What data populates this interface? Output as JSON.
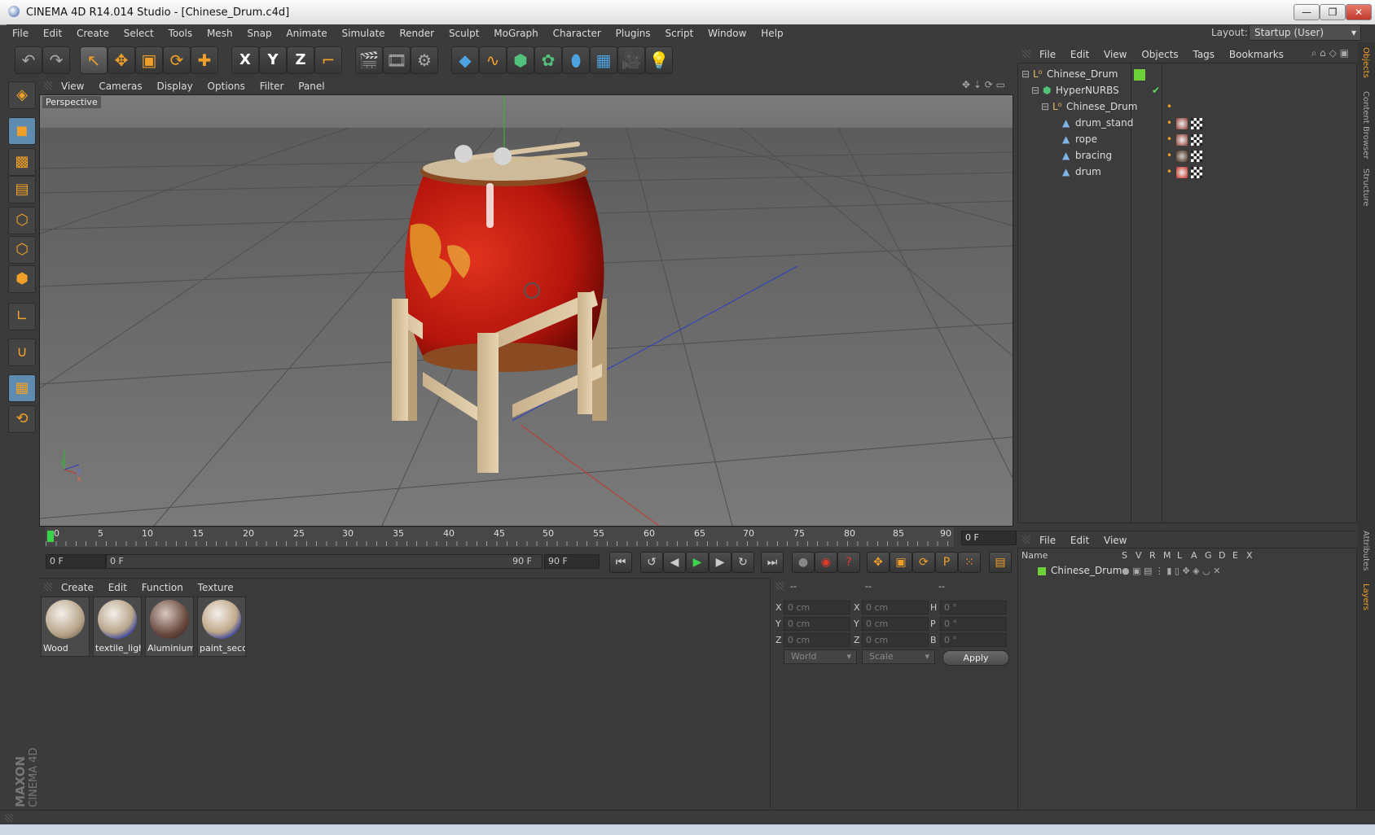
{
  "window": {
    "title": "CINEMA 4D R14.014 Studio - [Chinese_Drum.c4d]",
    "min_label": "—",
    "max_label": "❐",
    "close_label": "✕"
  },
  "menubar": {
    "items": [
      "File",
      "Edit",
      "Create",
      "Select",
      "Tools",
      "Mesh",
      "Snap",
      "Animate",
      "Simulate",
      "Render",
      "Sculpt",
      "MoGraph",
      "Character",
      "Plugins",
      "Script",
      "Window",
      "Help"
    ]
  },
  "layout": {
    "label": "Layout:",
    "value": "Startup (User)"
  },
  "toolbar": {
    "axis_x": "X",
    "axis_y": "Y",
    "axis_z": "Z"
  },
  "viewport": {
    "menu": [
      "View",
      "Cameras",
      "Display",
      "Options",
      "Filter",
      "Panel"
    ],
    "camera_label": "Perspective",
    "axis_y": "Y",
    "axis_z": "Z",
    "axis_x": "X"
  },
  "timeline": {
    "ticks": [
      "0",
      "5",
      "10",
      "15",
      "20",
      "25",
      "30",
      "35",
      "40",
      "45",
      "50",
      "55",
      "60",
      "65",
      "70",
      "75",
      "80",
      "85",
      "90"
    ],
    "current_frame": "0 F",
    "start_field": "0 F",
    "range_start": "0 F",
    "range_end": "90 F",
    "end_field": "90 F"
  },
  "materials": {
    "menu": [
      "Create",
      "Edit",
      "Function",
      "Texture"
    ],
    "items": [
      {
        "name": "Wood"
      },
      {
        "name": "textile_ligh"
      },
      {
        "name": "Aluminium"
      },
      {
        "name": "paint_seco"
      }
    ]
  },
  "coordinates": {
    "headers": [
      "--",
      "--",
      "--"
    ],
    "rows": [
      {
        "l1": "X",
        "v1": "0 cm",
        "l2": "X",
        "v2": "0 cm",
        "l3": "H",
        "v3": "0 °"
      },
      {
        "l1": "Y",
        "v1": "0 cm",
        "l2": "Y",
        "v2": "0 cm",
        "l3": "P",
        "v3": "0 °"
      },
      {
        "l1": "Z",
        "v1": "0 cm",
        "l2": "Z",
        "v2": "0 cm",
        "l3": "B",
        "v3": "0 °"
      }
    ],
    "space": "World",
    "mode": "Scale",
    "apply_label": "Apply"
  },
  "object_manager": {
    "menu": [
      "File",
      "Edit",
      "View",
      "Objects",
      "Tags",
      "Bookmarks"
    ],
    "objects": [
      {
        "name": "Chinese_Drum"
      },
      {
        "name": "HyperNURBS"
      },
      {
        "name": "Chinese_Drum"
      },
      {
        "name": "drum_stand"
      },
      {
        "name": "rope"
      },
      {
        "name": "bracing"
      },
      {
        "name": "drum"
      }
    ]
  },
  "layer_manager": {
    "menu": [
      "File",
      "Edit",
      "View"
    ],
    "columns": [
      "Name",
      "S",
      "V",
      "R",
      "M",
      "L",
      "A",
      "G",
      "D",
      "E",
      "X"
    ],
    "layers": [
      {
        "name": "Chinese_Drum",
        "color": "#6fd13a"
      }
    ]
  },
  "side_tabs": [
    "Objects",
    "Content Browser",
    "Structure",
    "Attributes",
    "Layers"
  ],
  "branding": {
    "maxon": "MAXON",
    "cinema": "CINEMA 4D"
  },
  "colors": {
    "accent": "#f0a028",
    "selection": "#5f8bb0",
    "drum_red": "#c81e14"
  },
  "icons": [
    "undo-icon",
    "redo-icon",
    "select-icon",
    "move-icon",
    "scale-icon",
    "rotate-icon",
    "add-icon",
    "x-axis-icon",
    "y-axis-icon",
    "z-axis-icon",
    "coord-system-icon",
    "render-view-icon",
    "render-pic-icon",
    "render-settings-icon",
    "cube-icon",
    "spline-icon",
    "nurbs-icon",
    "array-icon",
    "deformer-icon",
    "floor-icon",
    "camera-icon",
    "light-icon"
  ]
}
